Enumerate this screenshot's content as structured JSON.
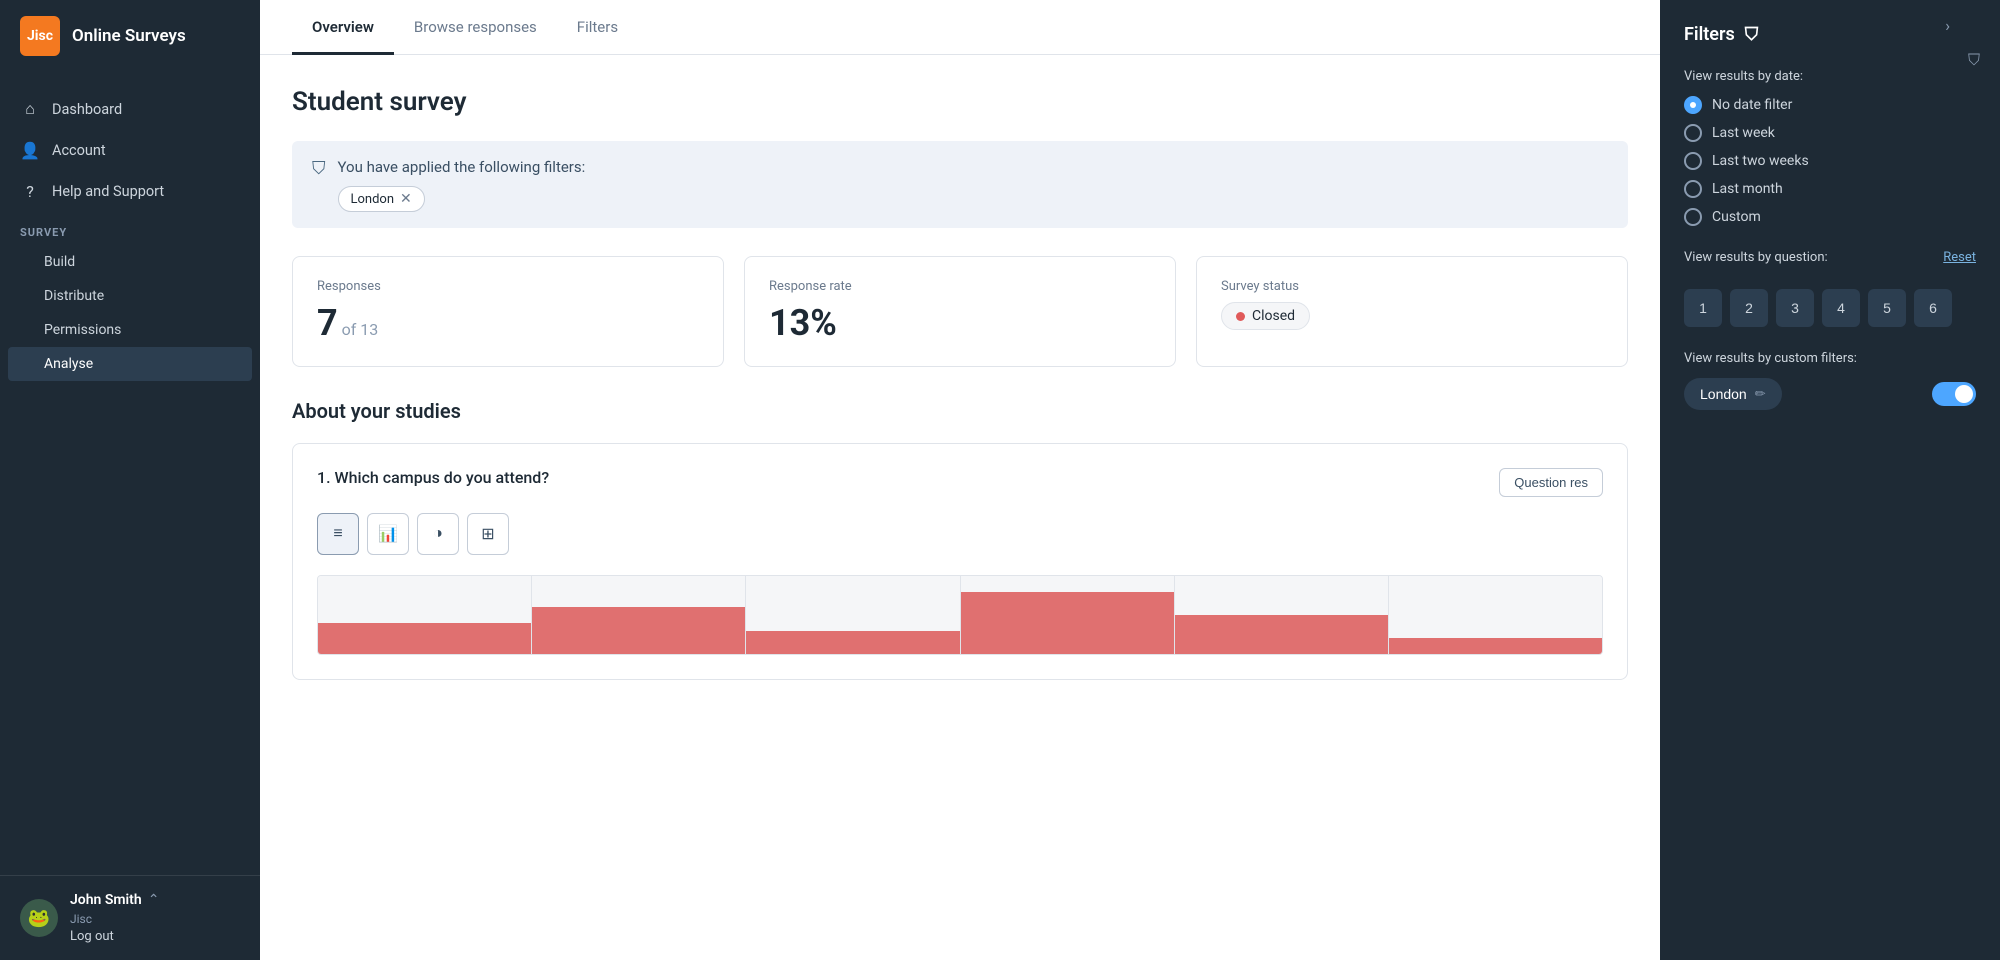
{
  "app": {
    "logo_text": "Jisc",
    "title": "Online Surveys"
  },
  "sidebar": {
    "nav_items": [
      {
        "id": "dashboard",
        "label": "Dashboard",
        "icon": "⌂"
      },
      {
        "id": "account",
        "label": "Account",
        "icon": "👤"
      },
      {
        "id": "help",
        "label": "Help and Support",
        "icon": "?"
      }
    ],
    "survey_section_label": "SURVEY",
    "survey_sub_items": [
      {
        "id": "build",
        "label": "Build",
        "active": false
      },
      {
        "id": "distribute",
        "label": "Distribute",
        "active": false
      },
      {
        "id": "permissions",
        "label": "Permissions",
        "active": false
      },
      {
        "id": "analyse",
        "label": "Analyse",
        "active": true
      }
    ],
    "user": {
      "name": "John Smith",
      "org": "Jisc",
      "logout_label": "Log out"
    }
  },
  "tabs": [
    {
      "id": "overview",
      "label": "Overview",
      "active": true
    },
    {
      "id": "browse-responses",
      "label": "Browse responses",
      "active": false
    },
    {
      "id": "filters",
      "label": "Filters",
      "active": false
    }
  ],
  "main": {
    "page_title": "Student survey",
    "filter_notice": {
      "text": "You have applied the following filters:",
      "tags": [
        "London"
      ]
    },
    "stats": {
      "responses_label": "Responses",
      "responses_value": "7",
      "responses_sub": "of 13",
      "rate_label": "Response rate",
      "rate_value": "13%",
      "status_label": "Survey status",
      "status_value": "Closed"
    },
    "section_heading": "About your studies",
    "question": {
      "title": "1. Which campus do you attend?",
      "reset_btn_label": "Question res",
      "chart_types": [
        "table",
        "bar",
        "pie",
        "grid"
      ],
      "bar_data": [
        40,
        60,
        30,
        80,
        50,
        20
      ]
    }
  },
  "filter_panel": {
    "title": "Filters",
    "date_label": "View results by date:",
    "date_options": [
      {
        "id": "no-date",
        "label": "No date filter",
        "selected": true
      },
      {
        "id": "last-week",
        "label": "Last week",
        "selected": false
      },
      {
        "id": "last-two-weeks",
        "label": "Last two weeks",
        "selected": false
      },
      {
        "id": "last-month",
        "label": "Last month",
        "selected": false
      },
      {
        "id": "custom",
        "label": "Custom",
        "selected": false
      }
    ],
    "question_label": "View results by question:",
    "reset_label": "Reset",
    "question_numbers": [
      "1",
      "2",
      "3",
      "4",
      "5",
      "6"
    ],
    "custom_filters_label": "View results by custom filters:",
    "custom_filter_name": "London"
  }
}
